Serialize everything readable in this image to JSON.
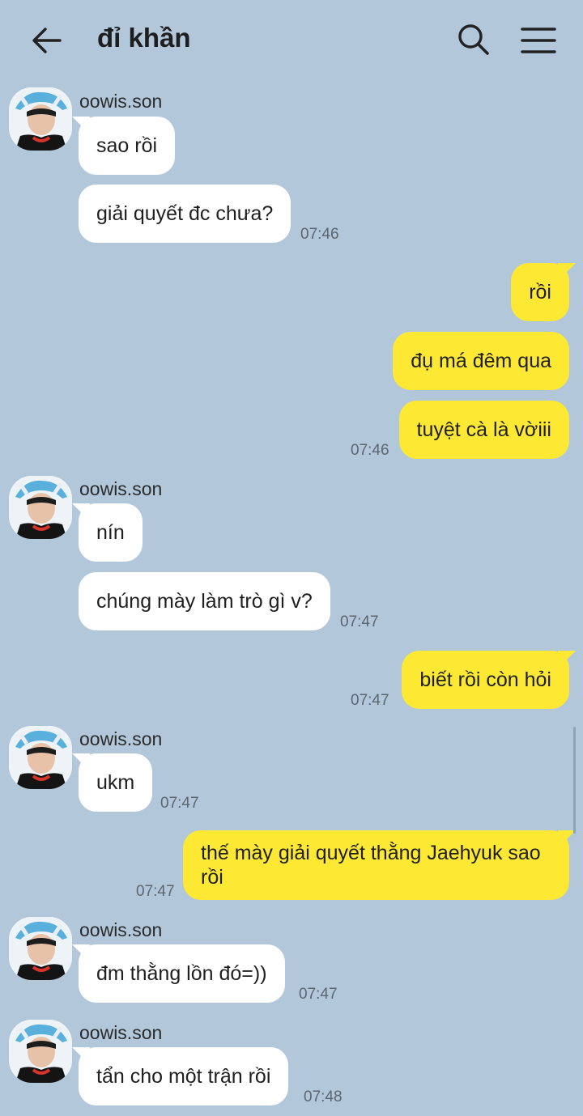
{
  "header": {
    "title": "đỉ khần",
    "back_icon": "arrow-left-icon",
    "search_icon": "search-icon",
    "menu_icon": "menu-icon"
  },
  "colors": {
    "background": "#b2c7da",
    "incoming_bubble": "#ffffff",
    "outgoing_bubble": "#fde834"
  },
  "messages": [
    {
      "sender": "oowis.son",
      "text": "sao rồi"
    },
    {
      "text": "giải quyết đc chưa?",
      "time": "07:46"
    },
    {
      "text": "rồi"
    },
    {
      "text": "đụ má đêm qua"
    },
    {
      "text": "tuyệt cà là vờiii",
      "time": "07:46"
    },
    {
      "sender": "oowis.son",
      "text": "nín"
    },
    {
      "text": "chúng mày làm trò gì v?",
      "time": "07:47"
    },
    {
      "text": "biết rồi còn hỏi",
      "time": "07:47"
    },
    {
      "sender": "oowis.son",
      "text": "ukm",
      "time": "07:47"
    },
    {
      "text": "thế mày giải quyết thằng Jaehyuk sao rồi",
      "time": "07:47"
    },
    {
      "sender": "oowis.son",
      "text": "đm thằng lồn đó=))",
      "time": "07:47"
    },
    {
      "sender": "oowis.son",
      "text": "tẩn cho một trận rồi",
      "time": "07:48"
    }
  ]
}
